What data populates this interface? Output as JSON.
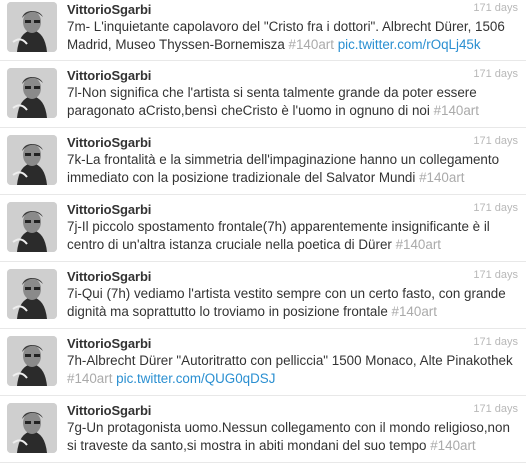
{
  "tweets": [
    {
      "user": "VittorioSgarbi",
      "time": "171 days",
      "text": "7m- L'inquietante capolavoro del \"Cristo fra i dottori\". Albrecht Dürer, 1506 Madrid, Museo Thyssen-Bornemisza ",
      "hashtag": "#140art",
      "link": "pic.twitter.com/rOqLj45k"
    },
    {
      "user": "VittorioSgarbi",
      "time": "171 days",
      "text": "7l-Non significa che l'artista si senta talmente grande da poter essere paragonato aCristo,bensì cheCristo è l'uomo in ognuno di noi ",
      "hashtag": "#140art",
      "link": ""
    },
    {
      "user": "VittorioSgarbi",
      "time": "171 days",
      "text": "7k-La frontalità e la simmetria dell'impaginazione hanno un collegamento immediato con la posizione tradizionale del Salvator Mundi ",
      "hashtag": "#140art",
      "link": ""
    },
    {
      "user": "VittorioSgarbi",
      "time": "171 days",
      "text": "7j-Il piccolo spostamento frontale(7h) apparentemente insignificante è il centro di un'altra istanza cruciale nella poetica di Dürer ",
      "hashtag": "#140art",
      "link": ""
    },
    {
      "user": "VittorioSgarbi",
      "time": "171 days",
      "text": "7i-Qui (7h) vediamo l'artista vestito sempre con un certo fasto, con grande dignità ma soprattutto lo troviamo in posizione frontale ",
      "hashtag": "#140art",
      "link": ""
    },
    {
      "user": "VittorioSgarbi",
      "time": "171 days",
      "text": "7h-Albrecht Dürer \"Autoritratto con pelliccia\" 1500 Monaco, Alte Pinakothek ",
      "hashtag": "#140art",
      "link": "pic.twitter.com/QUG0qDSJ"
    },
    {
      "user": "VittorioSgarbi",
      "time": "171 days",
      "text": "7g-Un protagonista uomo.Nessun collegamento con il mondo religioso,non si traveste da santo,si mostra in abiti mondani del suo tempo ",
      "hashtag": "#140art",
      "link": ""
    }
  ]
}
